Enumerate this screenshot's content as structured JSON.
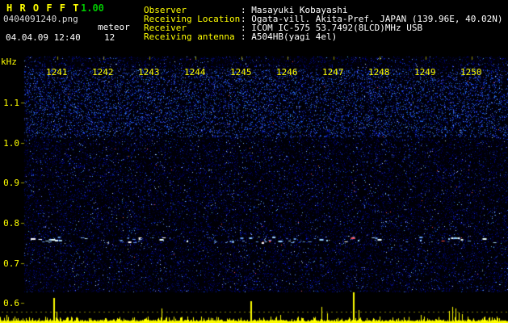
{
  "header": {
    "title": "H R O F F T",
    "version": "1.00",
    "filename": "0404091240.png",
    "mode": "meteor",
    "datetime": "04.04.09 12:40",
    "count": "12",
    "colors": {
      "title": "#ffff00",
      "version": "#00c800",
      "text": "#ffffff"
    }
  },
  "info": {
    "separator": ":",
    "rows": [
      {
        "label": "Observer",
        "value": "Masayuki Kobayashi"
      },
      {
        "label": "Receiving Location",
        "value": "Ogata-vill. Akita-Pref. JAPAN (139.96E, 40.02N)"
      },
      {
        "label": "Receiver",
        "value": "ICOM IC-575 53.7492(8LCD)MHz USB"
      },
      {
        "label": "Receiving antenna",
        "value": "A504HB(yagi 4el)"
      }
    ]
  },
  "spectrogram": {
    "unit_label": "kHz",
    "time_labels": [
      "1241",
      "1242",
      "1243",
      "1244",
      "1245",
      "1246",
      "1247",
      "1248",
      "1249",
      "1250"
    ],
    "freq_tick_labels": [
      "1.1",
      "1.0",
      "0.9",
      "0.8",
      "0.7",
      "0.6"
    ],
    "freq_axis_khz": {
      "min": 0.6,
      "max": 1.2
    },
    "echo_band_khz": 0.76,
    "colors": {
      "axis_label": "#ffff00",
      "noise_base": "#000006",
      "echo_bright": "#eaffff",
      "echo_red": "#ff5050"
    }
  },
  "level_graph": {
    "color": "#ffff00",
    "dotted_line_color": "#7a7a00",
    "peaks": [
      [
        8,
        9
      ],
      [
        18,
        7
      ],
      [
        40,
        5
      ],
      [
        66,
        30
      ],
      [
        70,
        13
      ],
      [
        130,
        5
      ],
      [
        166,
        6
      ],
      [
        200,
        17
      ],
      [
        232,
        7
      ],
      [
        270,
        6
      ],
      [
        310,
        26
      ],
      [
        347,
        9
      ],
      [
        375,
        5
      ],
      [
        398,
        19
      ],
      [
        405,
        11
      ],
      [
        437,
        37
      ],
      [
        444,
        15
      ],
      [
        470,
        7
      ],
      [
        500,
        6
      ],
      [
        521,
        9
      ],
      [
        556,
        14
      ],
      [
        560,
        19
      ],
      [
        564,
        17
      ],
      [
        568,
        12
      ],
      [
        572,
        10
      ],
      [
        600,
        7
      ],
      [
        616,
        5
      ]
    ]
  }
}
